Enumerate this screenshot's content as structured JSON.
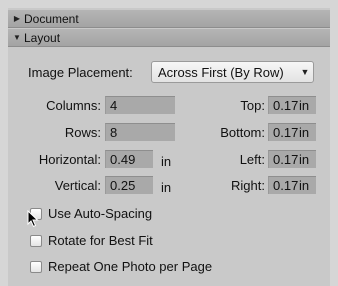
{
  "sections": {
    "document": {
      "title": "Document",
      "expanded": false,
      "arrow": "▶"
    },
    "layout": {
      "title": "Layout",
      "expanded": true,
      "arrow": "▼"
    }
  },
  "image_placement": {
    "label": "Image Placement:",
    "value": "Across First (By Row)",
    "arrow": "▼"
  },
  "fields": {
    "columns": {
      "label": "Columns:",
      "value": "4"
    },
    "rows": {
      "label": "Rows:",
      "value": "8"
    },
    "horizontal": {
      "label": "Horizontal:",
      "value": "0.49",
      "unit": "in"
    },
    "vertical": {
      "label": "Vertical:",
      "value": "0.25",
      "unit": "in"
    },
    "top": {
      "label": "Top:",
      "value": "0.17",
      "unit": "in"
    },
    "bottom": {
      "label": "Bottom:",
      "value": "0.17",
      "unit": "in"
    },
    "left": {
      "label": "Left:",
      "value": "0.17",
      "unit": "in"
    },
    "right": {
      "label": "Right:",
      "value": "0.17",
      "unit": "in"
    }
  },
  "checkboxes": [
    {
      "label": "Use Auto-Spacing",
      "checked": false
    },
    {
      "label": "Rotate for Best Fit",
      "checked": false
    },
    {
      "label": "Repeat One Photo per Page",
      "checked": false
    }
  ],
  "colors": {
    "panel": "#c9c9c9",
    "header": "#aaaaaa",
    "field": "#a9a9a9"
  }
}
